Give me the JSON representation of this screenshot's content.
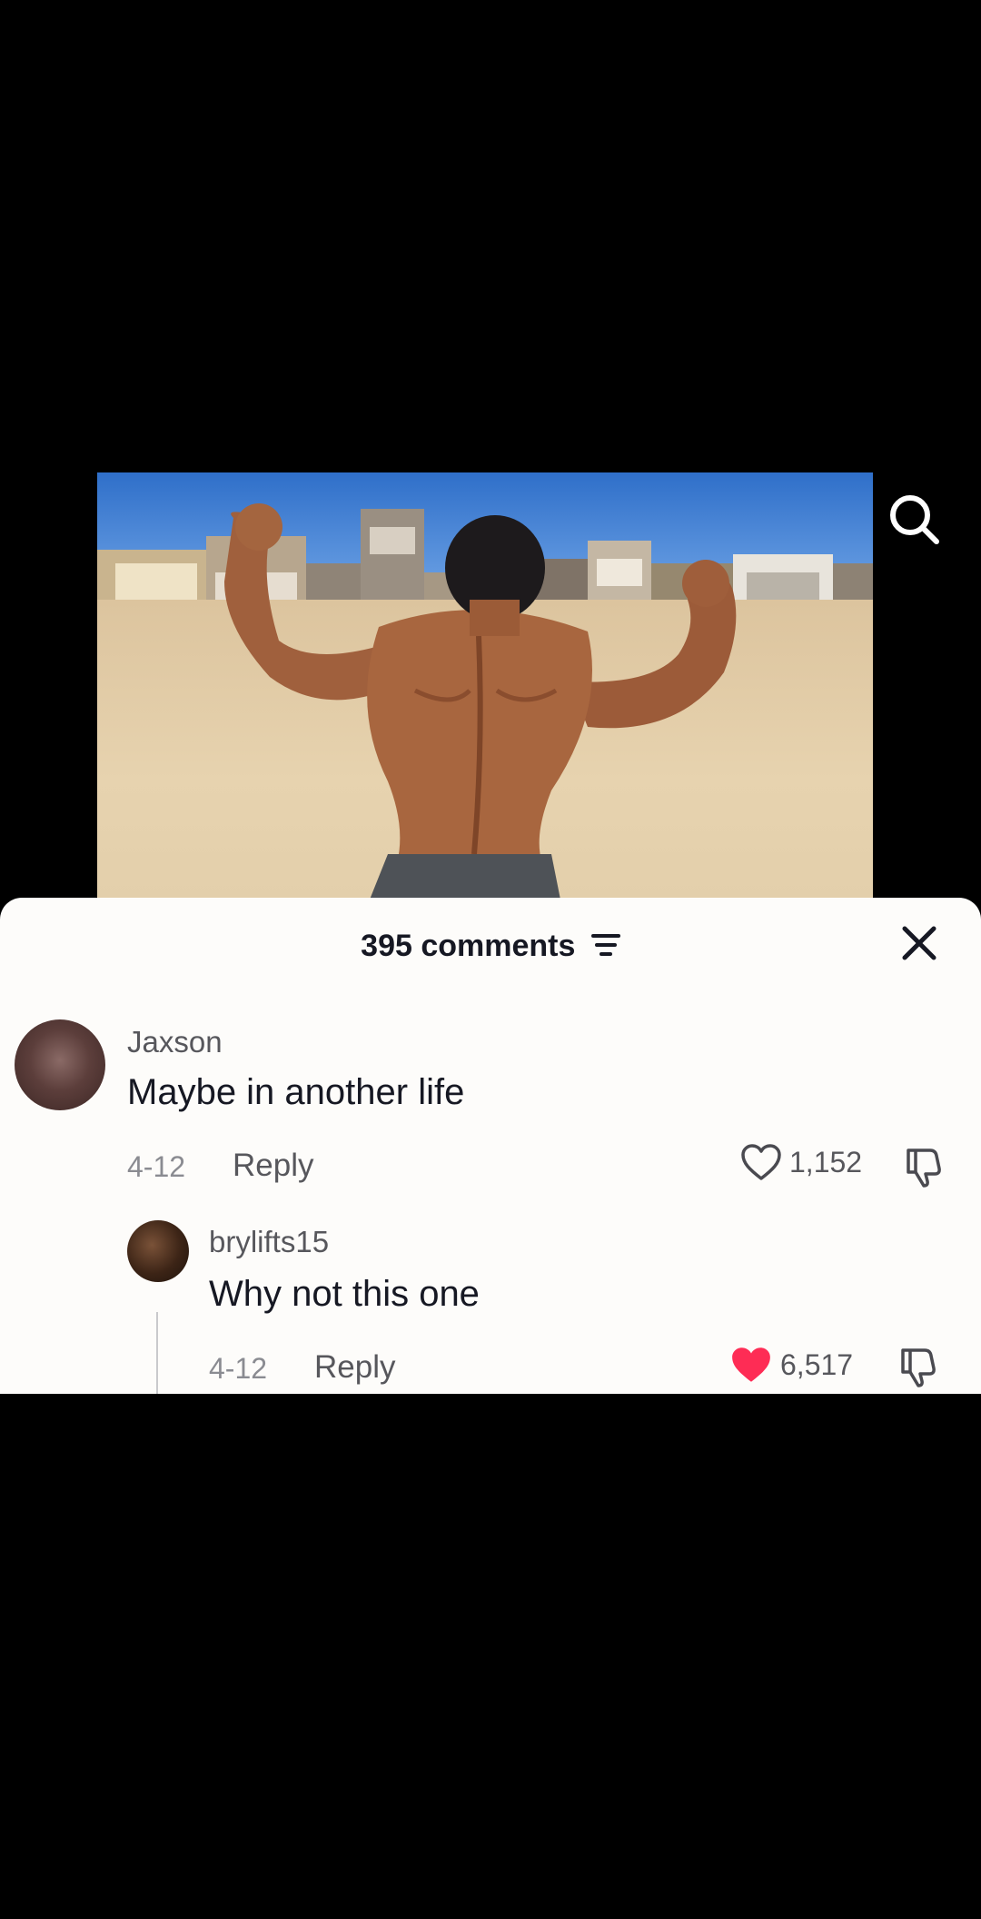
{
  "header": {
    "comments_count": "395 comments"
  },
  "icons": {
    "search": "search-icon",
    "filter": "filter-icon",
    "close": "close-icon",
    "like": "heart-icon",
    "dislike": "thumbs-down-icon"
  },
  "colors": {
    "liked_heart": "#fe2c55",
    "text_primary": "#161823",
    "text_secondary": "#57575c"
  },
  "comments": [
    {
      "username": "Jaxson",
      "text": "Maybe in another life",
      "date": "4-12",
      "reply_label": "Reply",
      "likes": "1,152",
      "liked": false,
      "replies": [
        {
          "username": "brylifts15",
          "text": "Why not this one",
          "date": "4-12",
          "reply_label": "Reply",
          "likes": "6,517",
          "liked": true
        }
      ]
    }
  ]
}
